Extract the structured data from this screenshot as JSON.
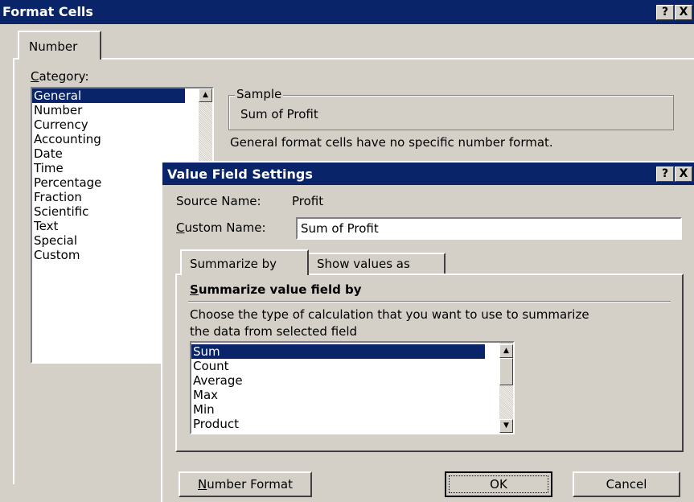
{
  "format_cells": {
    "title": "Format Cells",
    "help_btn": "?",
    "close_btn": "X",
    "tab": "Number",
    "category_label_prefix": "C",
    "category_label_rest": "ategory:",
    "categories": [
      "General",
      "Number",
      "Currency",
      "Accounting",
      "Date",
      "Time",
      "Percentage",
      "Fraction",
      "Scientific",
      "Text",
      "Special",
      "Custom"
    ],
    "selected_category": "General",
    "sample_label": "Sample",
    "sample_value": "Sum of Profit",
    "description": "General format cells have no specific number format."
  },
  "value_field_settings": {
    "title": "Value Field Settings",
    "help_btn": "?",
    "close_btn": "X",
    "source_label": "Source Name:",
    "source_value": "Profit",
    "custom_name_label_prefix": "C",
    "custom_name_label_rest": "ustom Name:",
    "custom_name_value": "Sum of Profit",
    "tabs": [
      "Summarize by",
      "Show values as"
    ],
    "section_heading_prefix": "S",
    "section_heading_rest": "ummarize value field by",
    "instruction_line1": "Choose the type of calculation that you want to use to summarize",
    "instruction_line2": "the data from selected field",
    "functions": [
      "Sum",
      "Count",
      "Average",
      "Max",
      "Min",
      "Product"
    ],
    "selected_function": "Sum",
    "number_format_prefix": "N",
    "number_format_rest": "umber Format",
    "ok_label": "OK",
    "cancel_label": "Cancel"
  }
}
